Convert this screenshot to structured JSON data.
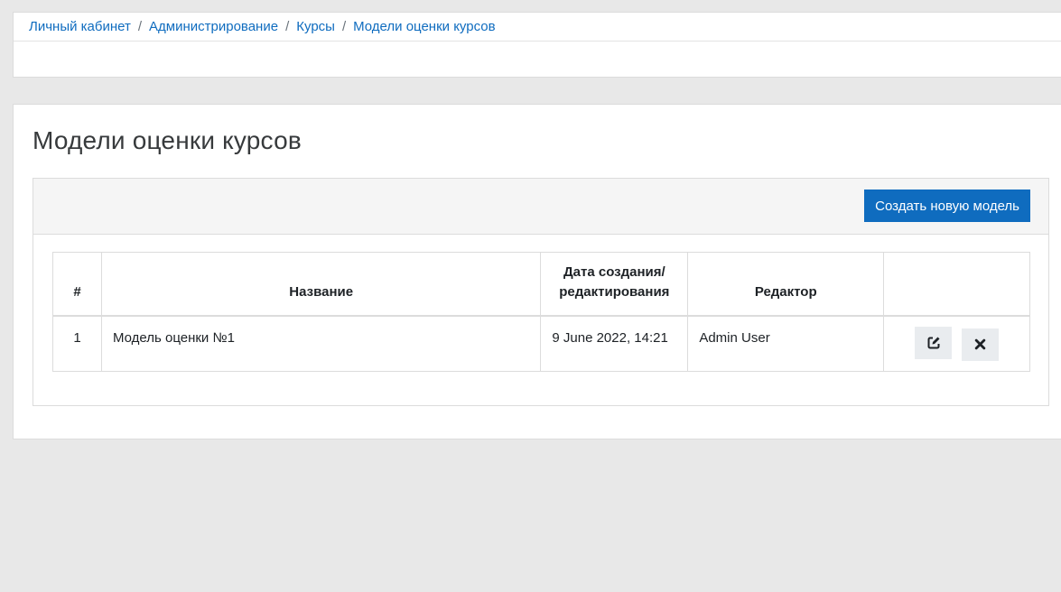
{
  "breadcrumb": {
    "items": [
      "Личный кабинет",
      "Администрирование",
      "Курсы",
      "Модели оценки курсов"
    ],
    "separator": "/"
  },
  "page": {
    "title": "Модели оценки курсов"
  },
  "toolbar": {
    "create_label": "Создать новую модель"
  },
  "table": {
    "headers": [
      "#",
      "Название",
      "Дата создания/\nредактирования",
      "Редактор",
      ""
    ],
    "header_date_line1": "Дата создания/",
    "header_date_line2": "редактирования",
    "rows": [
      {
        "num": "1",
        "name": "Модель оценки №1",
        "date": "9 June 2022, 14:21",
        "editor": "Admin User",
        "actions": [
          "edit-icon",
          "close-icon"
        ]
      }
    ]
  },
  "colors": {
    "accent": "#0f6cbf",
    "background": "#e8e8e8",
    "panel_header": "#f5f5f5",
    "icon_button": "#e9ecef"
  }
}
